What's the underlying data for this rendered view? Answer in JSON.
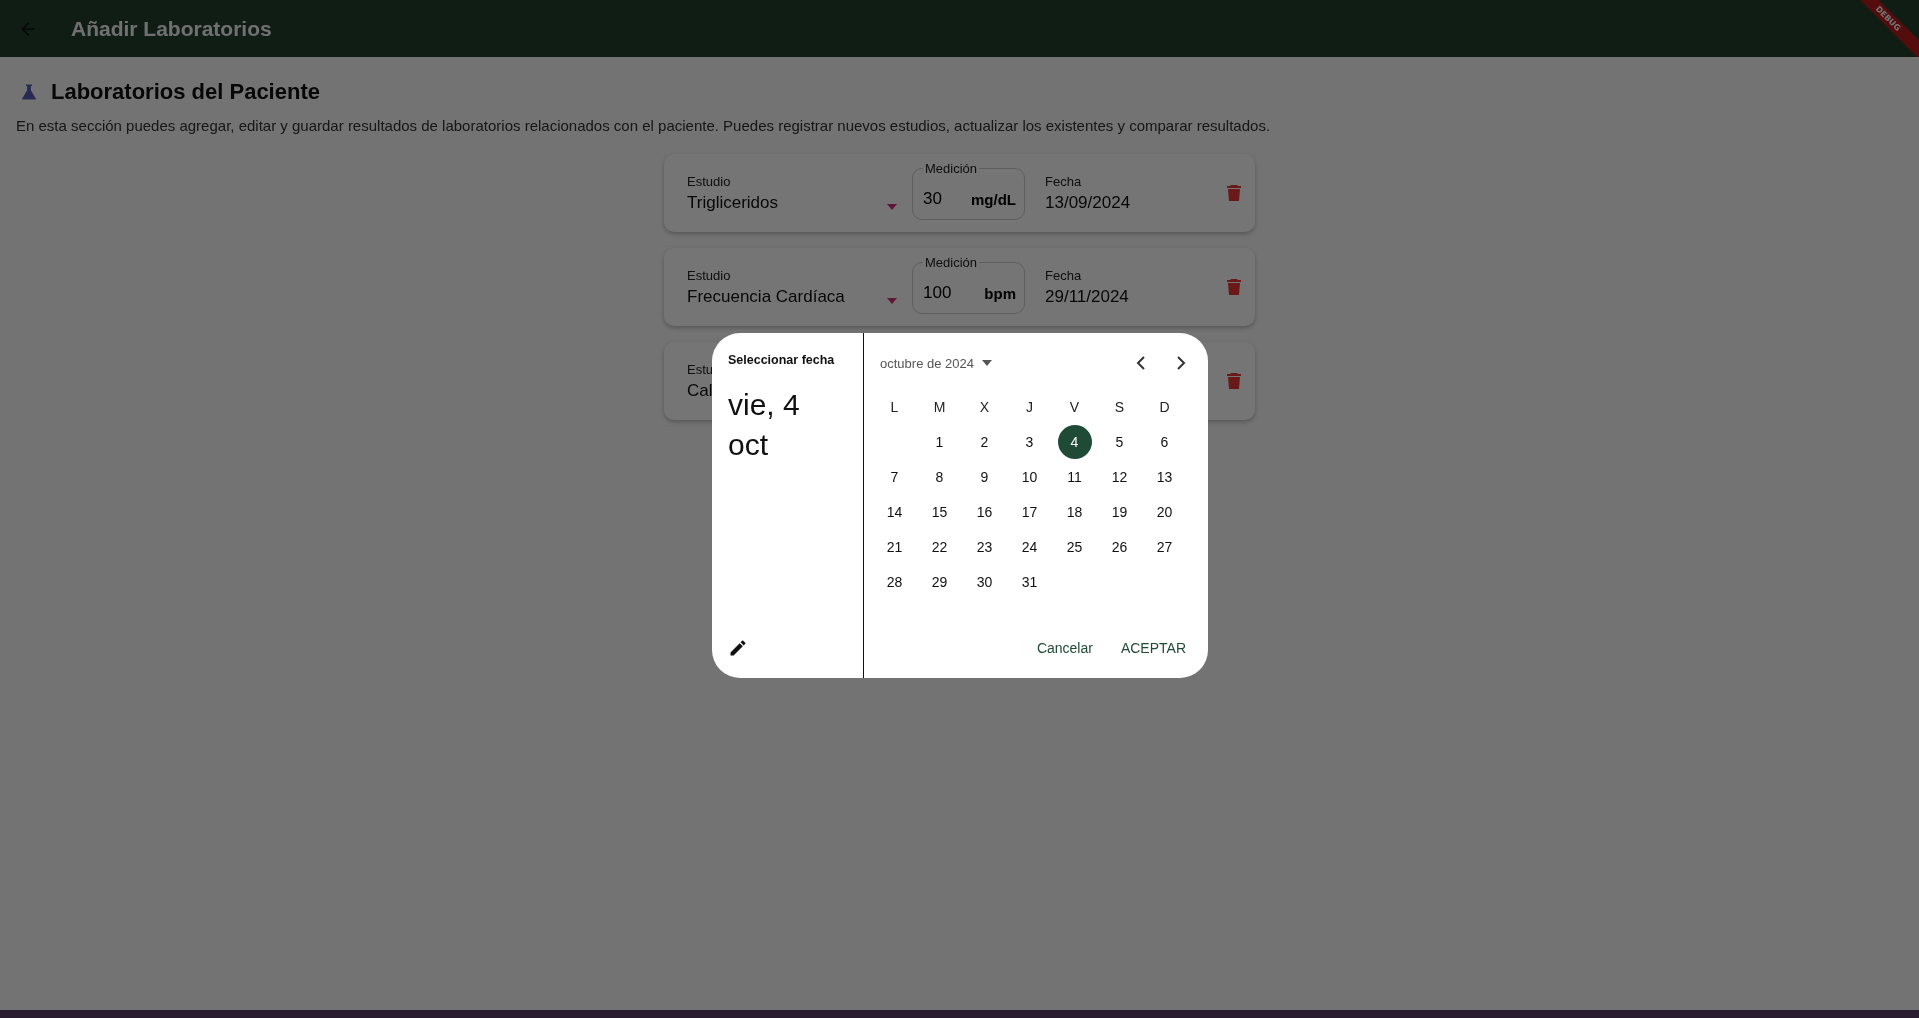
{
  "app_bar": {
    "title": "Añadir Laboratorios",
    "debug_banner": "DEBUG"
  },
  "section": {
    "title": "Laboratorios del Paciente",
    "description": "En esta sección puedes agregar, editar y guardar resultados de laboratorios relacionados con el paciente. Puedes registrar nuevos estudios, actualizar los existentes y comparar resultados."
  },
  "lab_cards": [
    {
      "study_label": "Estudio",
      "study": "Trigliceridos",
      "measure_label": "Medición",
      "value": "30",
      "unit": "mg/dL",
      "date_label": "Fecha",
      "date": "13/09/2024"
    },
    {
      "study_label": "Estudio",
      "study": "Frecuencia Cardíaca",
      "measure_label": "Medición",
      "value": "100",
      "unit": "bpm",
      "date_label": "Fecha",
      "date": "29/11/2024"
    },
    {
      "study_label": "Estu",
      "study": "Cal"
    }
  ],
  "date_picker": {
    "header": "Seleccionar fecha",
    "selected_date": "vie, 4 oct",
    "month": "octubre de 2024",
    "weekdays": [
      "L",
      "M",
      "X",
      "J",
      "V",
      "S",
      "D"
    ],
    "weeks": [
      [
        {
          "kind": "empty"
        },
        {
          "day": "1",
          "selected": false
        },
        {
          "day": "2",
          "selected": false
        },
        {
          "day": "3",
          "selected": false
        },
        {
          "day": "4",
          "selected": true
        },
        {
          "day": "5",
          "selected": false
        },
        {
          "day": "6",
          "selected": false
        }
      ],
      [
        {
          "day": "7",
          "selected": false
        },
        {
          "day": "8",
          "selected": false
        },
        {
          "day": "9",
          "selected": false
        },
        {
          "day": "10",
          "selected": false
        },
        {
          "day": "11",
          "selected": false
        },
        {
          "day": "12",
          "selected": false
        },
        {
          "day": "13",
          "selected": false
        }
      ],
      [
        {
          "day": "14",
          "selected": false
        },
        {
          "day": "15",
          "selected": false
        },
        {
          "day": "16",
          "selected": false
        },
        {
          "day": "17",
          "selected": false
        },
        {
          "day": "18",
          "selected": false
        },
        {
          "day": "19",
          "selected": false
        },
        {
          "day": "20",
          "selected": false
        }
      ],
      [
        {
          "day": "21",
          "selected": false
        },
        {
          "day": "22",
          "selected": false
        },
        {
          "day": "23",
          "selected": false
        },
        {
          "day": "24",
          "selected": false
        },
        {
          "day": "25",
          "selected": false
        },
        {
          "day": "26",
          "selected": false
        },
        {
          "day": "27",
          "selected": false
        }
      ],
      [
        {
          "day": "28",
          "selected": false
        },
        {
          "day": "29",
          "selected": false
        },
        {
          "day": "30",
          "selected": false
        },
        {
          "day": "31",
          "selected": false
        }
      ]
    ],
    "buttons": [
      "Cancelar",
      "ACEPTAR"
    ]
  }
}
